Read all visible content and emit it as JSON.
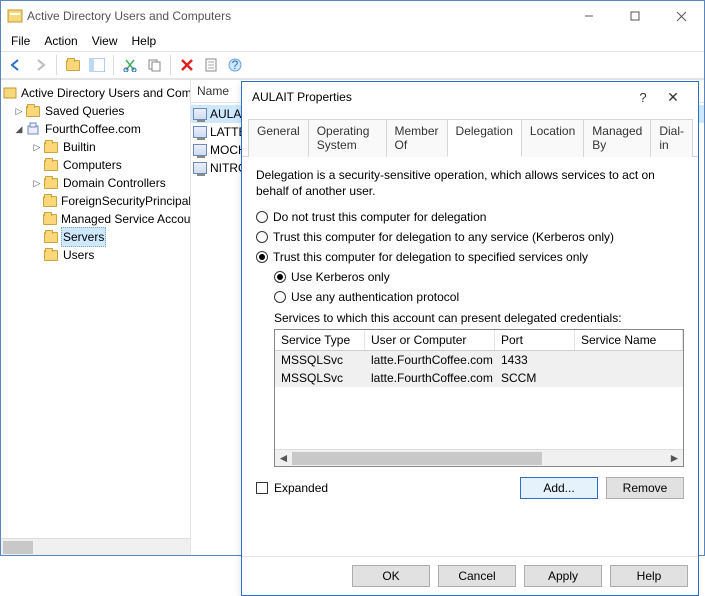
{
  "title": "Active Directory Users and Computers",
  "menus": [
    "File",
    "Action",
    "View",
    "Help"
  ],
  "tree": {
    "root": "Active Directory Users and Computers",
    "saved_queries": "Saved Queries",
    "domain": "FourthCoffee.com",
    "domain_children": [
      "Builtin",
      "Computers",
      "Domain Controllers",
      "ForeignSecurityPrincipals",
      "Managed Service Accounts",
      "Servers",
      "Users"
    ]
  },
  "list": {
    "header": "Name",
    "items": [
      "AULAIT",
      "LATTE",
      "MOCHA",
      "NITRO"
    ],
    "selected": 0
  },
  "dialog": {
    "title": "AULAIT Properties",
    "tabs": [
      "General",
      "Operating System",
      "Member Of",
      "Delegation",
      "Location",
      "Managed By",
      "Dial-in"
    ],
    "active_tab": 3,
    "desc": "Delegation is a security-sensitive operation, which allows services to act on behalf of another user.",
    "radios": {
      "r1": "Do not trust this computer for delegation",
      "r2": "Trust this computer for delegation to any service (Kerberos only)",
      "r3": "Trust this computer for delegation to specified services only",
      "sub1": "Use Kerberos only",
      "sub2": "Use any authentication protocol"
    },
    "services_label": "Services to which this account can present delegated credentials:",
    "grid": {
      "cols": [
        "Service Type",
        "User or Computer",
        "Port",
        "Service Name"
      ],
      "rows": [
        {
          "type": "MSSQLSvc",
          "uc": "latte.FourthCoffee.com",
          "port": "1433"
        },
        {
          "type": "MSSQLSvc",
          "uc": "latte.FourthCoffee.com",
          "port": "SCCM"
        }
      ]
    },
    "expanded_label": "Expanded",
    "buttons": {
      "add": "Add...",
      "remove": "Remove",
      "ok": "OK",
      "cancel": "Cancel",
      "apply": "Apply",
      "help": "Help"
    }
  }
}
